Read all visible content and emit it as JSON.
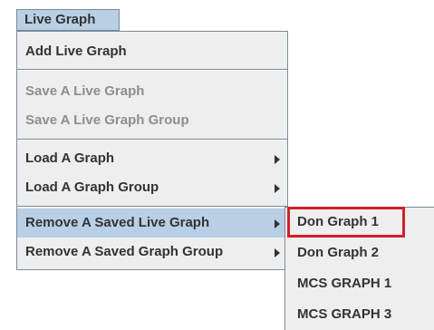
{
  "menubar": {
    "title": "Live Graph"
  },
  "dropdown": {
    "items": [
      {
        "label": "Add Live Graph",
        "enabled": true
      },
      {
        "label": "Save A Live Graph",
        "enabled": false
      },
      {
        "label": "Save A Live Graph Group",
        "enabled": false
      },
      {
        "label": "Load A Graph",
        "enabled": true,
        "has_submenu": true
      },
      {
        "label": "Load A Graph Group",
        "enabled": true,
        "has_submenu": true
      },
      {
        "label": "Remove A Saved Live Graph",
        "enabled": true,
        "has_submenu": true,
        "active": true
      },
      {
        "label": "Remove A Saved Graph Group",
        "enabled": true,
        "has_submenu": true
      }
    ]
  },
  "submenu": {
    "items": [
      {
        "label": "Don Graph 1",
        "highlighted": true
      },
      {
        "label": "Don Graph 2"
      },
      {
        "label": "MCS GRAPH 1"
      },
      {
        "label": "MCS GRAPH 3"
      }
    ]
  },
  "colors": {
    "menu_bg": "#eeeeee",
    "active_bg": "#b8cfe5",
    "highlight_border": "#d21f2a",
    "disabled_text": "#8e8e8e"
  }
}
